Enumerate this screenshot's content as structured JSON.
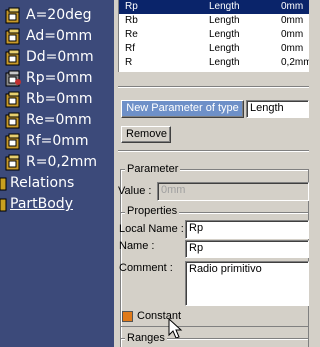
{
  "tree": {
    "items": [
      {
        "label": "A=20deg",
        "icon": "parameter-icon"
      },
      {
        "label": "Ad=0mm",
        "icon": "parameter-icon"
      },
      {
        "label": "Dd=0mm",
        "icon": "parameter-icon"
      },
      {
        "label": "Rp=0mm",
        "icon": "parameter-locked-icon"
      },
      {
        "label": "Rb=0mm",
        "icon": "parameter-icon"
      },
      {
        "label": "Re=0mm",
        "icon": "parameter-icon"
      },
      {
        "label": "Rf=0mm",
        "icon": "parameter-icon"
      },
      {
        "label": "R=0,2mm",
        "icon": "parameter-icon"
      },
      {
        "label": "Relations",
        "icon": "relations-icon"
      },
      {
        "label": "PartBody",
        "icon": "partbody-icon"
      }
    ]
  },
  "param_list": {
    "rows": [
      {
        "name": "Rp",
        "type": "Length",
        "value": "0mm",
        "selected": true
      },
      {
        "name": "Rb",
        "type": "Length",
        "value": "0mm",
        "selected": false
      },
      {
        "name": "Re",
        "type": "Length",
        "value": "0mm",
        "selected": false
      },
      {
        "name": "Rf",
        "type": "Length",
        "value": "0mm",
        "selected": false
      },
      {
        "name": "R",
        "type": "Length",
        "value": "0,2mm",
        "selected": false
      }
    ]
  },
  "new_param": {
    "button_label": "New Parameter of type",
    "type_value": "Length"
  },
  "remove_label": "Remove",
  "parameter_section": {
    "title": "Parameter",
    "value_label": "Value :",
    "value": "0mm",
    "properties_title": "Properties",
    "local_name_label": "Local Name :",
    "local_name": "Rp",
    "name_label": "Name :",
    "name": "Rp",
    "comment_label": "Comment :",
    "comment": "Radio primitivo",
    "constant_label": "Constant",
    "ranges_title": "Ranges"
  },
  "colors": {
    "tree_bg": "#3c4a7a",
    "selection": "#0a246a",
    "dialog_bg": "#d4d0c8"
  }
}
